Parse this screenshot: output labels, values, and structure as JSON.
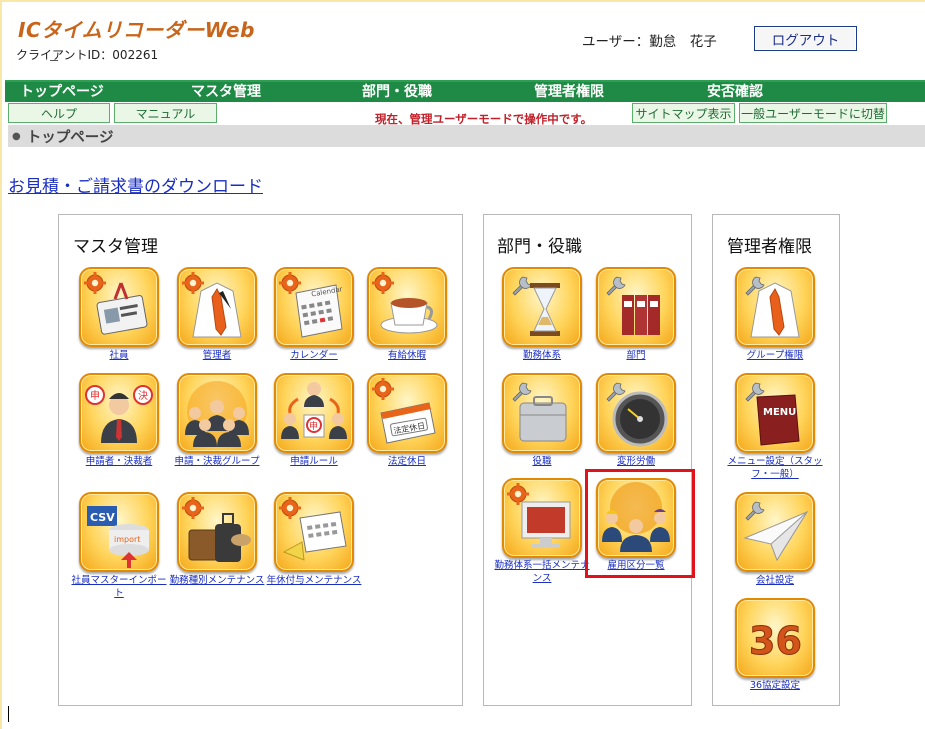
{
  "header": {
    "app_title": "ICタイムリコーダーWeb",
    "client_id": "クライアントID：002261",
    "user_label": "ユーザー：勤怠　花子",
    "logout_label": "ログアウト"
  },
  "nav": {
    "items": [
      "トップページ",
      "マスタ管理",
      "部門・役職",
      "管理者権限",
      "安否確認"
    ]
  },
  "subbar": {
    "help_label": "ヘルプ",
    "manual_label": "マニュアル",
    "mode_message": "現在、管理ユーザーモードで操作中です。",
    "sitemap_label": "サイトマップ表示",
    "switch_mode_label": "一般ユーザーモードに切替"
  },
  "breadcrumb": {
    "label": "トップページ"
  },
  "download_link": "お見積・ご請求書のダウンロード",
  "panels": {
    "master": {
      "title": "マスタ管理",
      "tiles": [
        {
          "label": "社員",
          "icon": "employee-card-icon"
        },
        {
          "label": "管理者",
          "icon": "shirt-tie-icon"
        },
        {
          "label": "カレンダー",
          "icon": "calendar-icon"
        },
        {
          "label": "有給休暇",
          "icon": "coffee-cup-icon"
        },
        {
          "label": "申請者・決裁者",
          "icon": "approver-person-icon"
        },
        {
          "label": "申請・決裁グループ",
          "icon": "group-people-icon"
        },
        {
          "label": "申請ルール",
          "icon": "application-rule-icon"
        },
        {
          "label": "法定休日",
          "icon": "holiday-calendar-icon"
        },
        {
          "label": "社員マスターインポート",
          "icon": "csv-import-icon"
        },
        {
          "label": "勤務種別メンテナンス",
          "icon": "luggage-icon"
        },
        {
          "label": "年休付与メンテナンス",
          "icon": "calendar-megaphone-icon"
        }
      ]
    },
    "dept": {
      "title": "部門・役職",
      "tiles": [
        {
          "label": "勤務体系",
          "icon": "hourglass-icon"
        },
        {
          "label": "部門",
          "icon": "binders-icon"
        },
        {
          "label": "役職",
          "icon": "briefcase-icon"
        },
        {
          "label": "変形労働",
          "icon": "speedometer-icon"
        },
        {
          "label": "勤務体系一括メンテナンス",
          "icon": "monitor-icon"
        },
        {
          "label": "雇用区分一覧",
          "icon": "workers-group-icon"
        }
      ]
    },
    "admin": {
      "title": "管理者権限",
      "tiles": [
        {
          "label": "グループ権限",
          "icon": "shirt-tie-icon"
        },
        {
          "label": "メニュー設定（スタッフ・一般）",
          "icon": "menu-book-icon"
        },
        {
          "label": "会社設定",
          "icon": "paper-plane-icon"
        },
        {
          "label": "36協定設定",
          "icon": "number-36-icon"
        }
      ]
    }
  },
  "tile_texts": {
    "calendar_word": "Calendar",
    "holiday_stamp": "法定休日",
    "csv": "CSV",
    "import": "import",
    "menu": "MENU",
    "num36": "36",
    "stamp_left": "申",
    "stamp_right": "決",
    "stamp_mid": "申"
  },
  "colors": {
    "nav_green": "#1e8a45",
    "title_orange": "#c8651b",
    "link_blue": "#1a2ec0",
    "highlight_red": "#e0131c"
  }
}
